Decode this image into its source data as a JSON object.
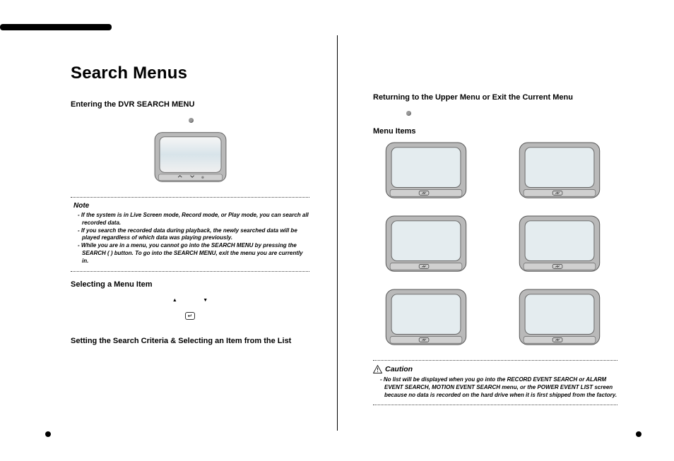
{
  "left": {
    "title": "Search Menus",
    "sections": {
      "entering": {
        "heading": "Entering the DVR SEARCH MENU"
      },
      "note_label": "Note",
      "notes": [
        "If the system is in Live Screen mode, Record mode, or Play mode, you can search all recorded data.",
        "If you search the recorded data during playback, the newly searched data will be played regardless of which data was playing previously.",
        "While you are in a menu, you cannot go into the SEARCH MENU by pressing the SEARCH (   ) button. To go into the SEARCH MENU, exit the menu you are currently in."
      ],
      "selecting": {
        "heading": "Selecting a Menu Item"
      },
      "criteria": {
        "heading": "Setting the Search Criteria & Selecting an Item from the List"
      }
    }
  },
  "right": {
    "returning": {
      "heading": "Returning to the Upper Menu or Exit the Current Menu"
    },
    "menu_items": {
      "heading": "Menu Items"
    },
    "caution_label": "Caution",
    "caution_notes": [
      "No list will be displayed when you go into the RECORD EVENT SEARCH or ALARM EVENT SEARCH, MOTION EVENT SEARCH menu, or the POWER EVENT LIST screen because no data is recorded on the hard drive when it is first shipped from the factory."
    ]
  },
  "glyphs": {
    "enter": "↵",
    "up": "▲",
    "down": "▼"
  }
}
